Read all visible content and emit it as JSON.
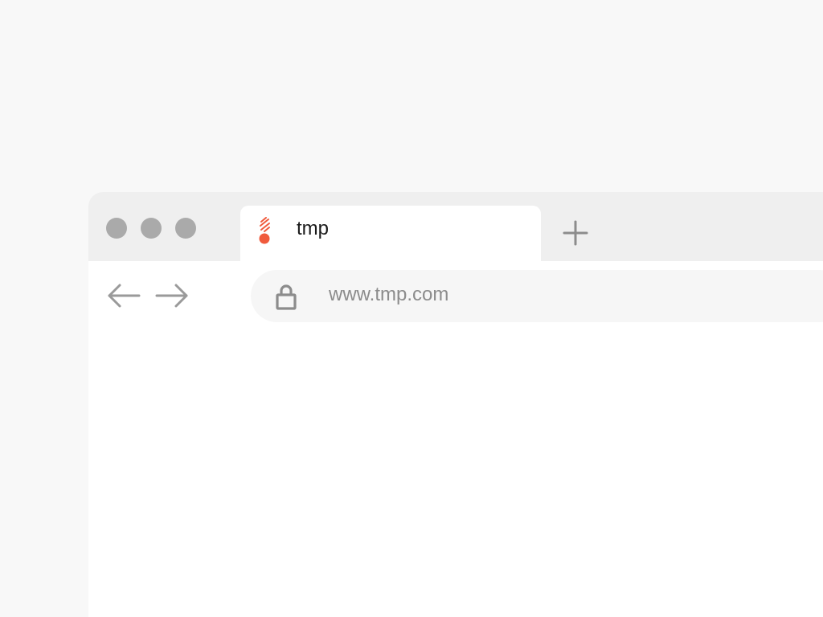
{
  "colors": {
    "page_background": "#f8f8f8",
    "tab_strip": "#efefef",
    "tab_active": "#ffffff",
    "traffic_light": "#aaaaaa",
    "icon_gray": "#8c8c8c",
    "favicon_accent": "#f05a3c",
    "address_bar_bg": "#f6f6f6"
  },
  "window_controls": [
    {
      "icon": "window-dot"
    },
    {
      "icon": "window-dot"
    },
    {
      "icon": "window-dot"
    }
  ],
  "tabs": [
    {
      "title": "tmp",
      "icon": "favicon-icon",
      "active": true
    }
  ],
  "new_tab": {
    "icon": "plus-icon"
  },
  "navigation": {
    "back_icon": "arrow-left-icon",
    "forward_icon": "arrow-right-icon"
  },
  "address_bar": {
    "url": "www.tmp.com",
    "icon": "lock-icon"
  }
}
